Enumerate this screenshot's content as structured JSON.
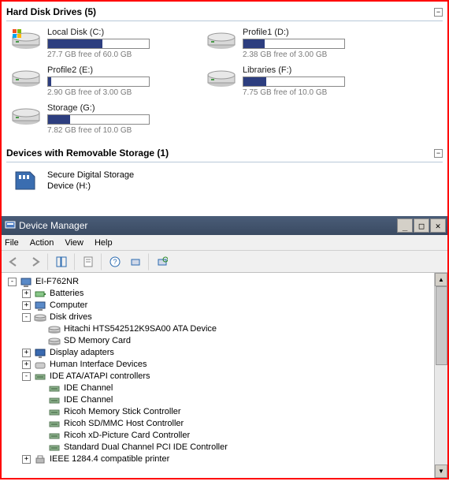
{
  "explorer": {
    "hdd_header": "Hard Disk Drives (5)",
    "rem_header": "Devices with Removable Storage (1)",
    "drives": [
      {
        "name": "Local Disk (C:)",
        "free_text": "27.7 GB free of 60.0 GB",
        "fill_pct": 54,
        "windows": true
      },
      {
        "name": "Profile1 (D:)",
        "free_text": "2.38 GB free of 3.00 GB",
        "fill_pct": 21
      },
      {
        "name": "Profile2 (E:)",
        "free_text": "2.90 GB free of 3.00 GB",
        "fill_pct": 3
      },
      {
        "name": "Libraries (F:)",
        "free_text": "7.75 GB free of 10.0 GB",
        "fill_pct": 23
      },
      {
        "name": "Storage (G:)",
        "free_text": "7.82 GB free of 10.0 GB",
        "fill_pct": 22
      }
    ],
    "removable": {
      "line1": "Secure Digital Storage",
      "line2": "Device (H:)"
    }
  },
  "devmgr": {
    "title": "Device Manager",
    "menu": {
      "file": "File",
      "action": "Action",
      "view": "View",
      "help": "Help"
    },
    "tree": [
      {
        "depth": 0,
        "exp": "-",
        "icon": "computer",
        "label": "EI-F762NR"
      },
      {
        "depth": 1,
        "exp": "+",
        "icon": "battery",
        "label": "Batteries"
      },
      {
        "depth": 1,
        "exp": "+",
        "icon": "computer",
        "label": "Computer"
      },
      {
        "depth": 1,
        "exp": "-",
        "icon": "disk",
        "label": "Disk drives"
      },
      {
        "depth": 2,
        "exp": " ",
        "icon": "disk",
        "label": "Hitachi HTS542512K9SA00 ATA Device"
      },
      {
        "depth": 2,
        "exp": " ",
        "icon": "disk",
        "label": "SD Memory Card"
      },
      {
        "depth": 1,
        "exp": "+",
        "icon": "display",
        "label": "Display adapters"
      },
      {
        "depth": 1,
        "exp": "+",
        "icon": "hid",
        "label": "Human Interface Devices"
      },
      {
        "depth": 1,
        "exp": "-",
        "icon": "ide",
        "label": "IDE ATA/ATAPI controllers"
      },
      {
        "depth": 2,
        "exp": " ",
        "icon": "ide",
        "label": "IDE Channel"
      },
      {
        "depth": 2,
        "exp": " ",
        "icon": "ide",
        "label": "IDE Channel"
      },
      {
        "depth": 2,
        "exp": " ",
        "icon": "ide",
        "label": "Ricoh Memory Stick Controller"
      },
      {
        "depth": 2,
        "exp": " ",
        "icon": "ide",
        "label": "Ricoh SD/MMC Host Controller"
      },
      {
        "depth": 2,
        "exp": " ",
        "icon": "ide",
        "label": "Ricoh xD-Picture Card Controller"
      },
      {
        "depth": 2,
        "exp": " ",
        "icon": "ide",
        "label": "Standard Dual Channel PCI IDE Controller"
      },
      {
        "depth": 1,
        "exp": "+",
        "icon": "printer",
        "label": "IEEE 1284.4 compatible printer"
      }
    ]
  }
}
